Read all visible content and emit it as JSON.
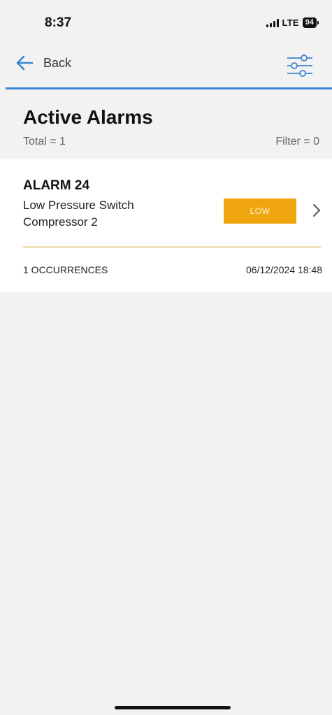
{
  "status_bar": {
    "time": "8:37",
    "network": "LTE",
    "battery": "94"
  },
  "nav": {
    "back_label": "Back",
    "back_icon": "arrow-left-icon",
    "filter_icon": "sliders-icon",
    "accent_color": "#3a85d4"
  },
  "header": {
    "title": "Active Alarms",
    "total": "Total = 1",
    "filter": "Filter = 0"
  },
  "alarms": [
    {
      "title": "ALARM 24",
      "description_line1": "Low Pressure Switch",
      "description_line2": "Compressor 2",
      "severity": "LOW",
      "severity_color": "#f0a60e",
      "occurrences": "1 OCCURRENCES",
      "timestamp": "06/12/2024 18:48",
      "chevron_icon": "chevron-right-icon"
    }
  ]
}
